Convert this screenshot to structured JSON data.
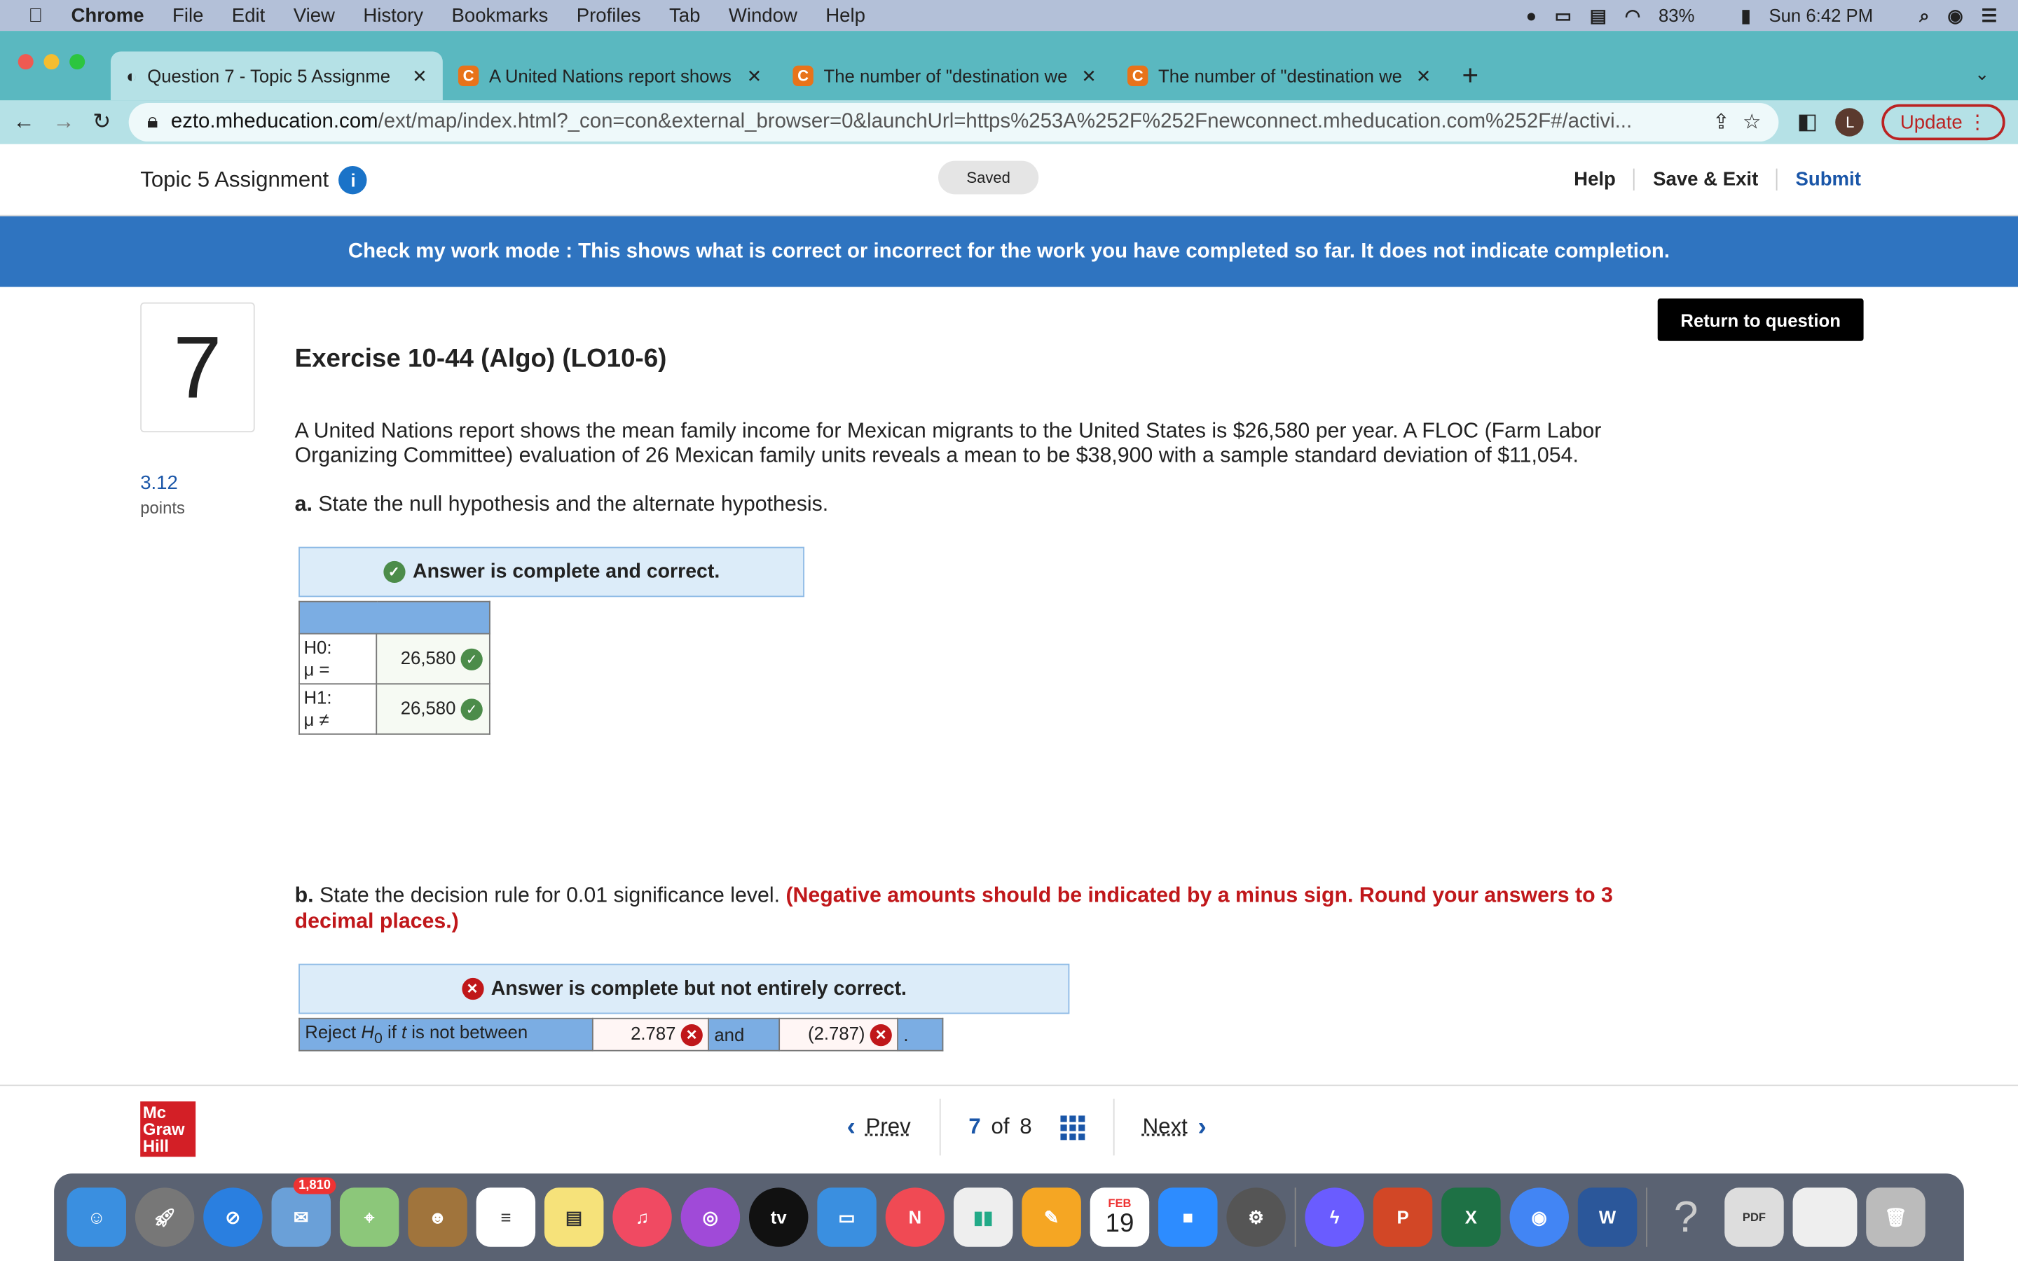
{
  "menubar": {
    "app": "Chrome",
    "items": [
      "File",
      "Edit",
      "View",
      "History",
      "Bookmarks",
      "Profiles",
      "Tab",
      "Window",
      "Help"
    ],
    "battery": "83%",
    "clock": "Sun 6:42 PM"
  },
  "tabs": [
    {
      "label": "Question 7 - Topic 5 Assignme",
      "active": true
    },
    {
      "label": "A United Nations report shows"
    },
    {
      "label": "The number of \"destination we"
    },
    {
      "label": "The number of \"destination we"
    }
  ],
  "address": {
    "host": "ezto.mheducation.com",
    "rest": "/ext/map/index.html?_con=con&external_browser=0&launchUrl=https%253A%252F%252Fnewconnect.mheducation.com%252F#/activi...",
    "avatar": "L",
    "update": "Update"
  },
  "header": {
    "title": "Topic 5 Assignment",
    "saved": "Saved",
    "help": "Help",
    "save_exit": "Save & Exit",
    "submit": "Submit"
  },
  "banner": "Check my work mode : This shows what is correct or incorrect for the work you have completed so far. It does not indicate completion.",
  "question": {
    "number": "7",
    "points": "3.12",
    "points_label": "points",
    "return": "Return to question",
    "title": "Exercise 10-44 (Algo) (LO10-6)",
    "text": "A United Nations report shows the mean family income for Mexican migrants to the United States is $26,580 per year. A FLOC (Farm Labor Organizing Committee) evaluation of 26 Mexican family units reveals a mean to be $38,900 with a sample standard deviation of $11,054.",
    "a": {
      "label": "a.",
      "text": " State the null hypothesis and the alternate hypothesis.",
      "status": "Answer is complete and correct.",
      "rows": [
        {
          "l1": "H0:",
          "l2": "μ =",
          "value": "26,580"
        },
        {
          "l1": "H1:",
          "l2": "μ ≠",
          "value": "26,580"
        }
      ]
    },
    "b": {
      "label": "b.",
      "text": " State the decision rule for 0.01 significance level. ",
      "note": "(Negative amounts should be indicated by a minus sign. Round your answers to 3 decimal places.)",
      "status": "Answer is complete but not entirely correct.",
      "reject": "Reject ",
      "h": "H",
      "sub": "0",
      "if": " if ",
      "t": "t",
      "between": " is not between",
      "v1": "2.787",
      "and": "and",
      "v2": "(2.787)",
      "dot": "."
    }
  },
  "footer": {
    "logo": [
      "Mc",
      "Graw",
      "Hill"
    ],
    "prev": "Prev",
    "current": "7",
    "of": "of",
    "total": "8",
    "next": "Next"
  },
  "dock": {
    "mail_badge": "1,810",
    "calendar_month": "FEB",
    "calendar_day": "19"
  }
}
